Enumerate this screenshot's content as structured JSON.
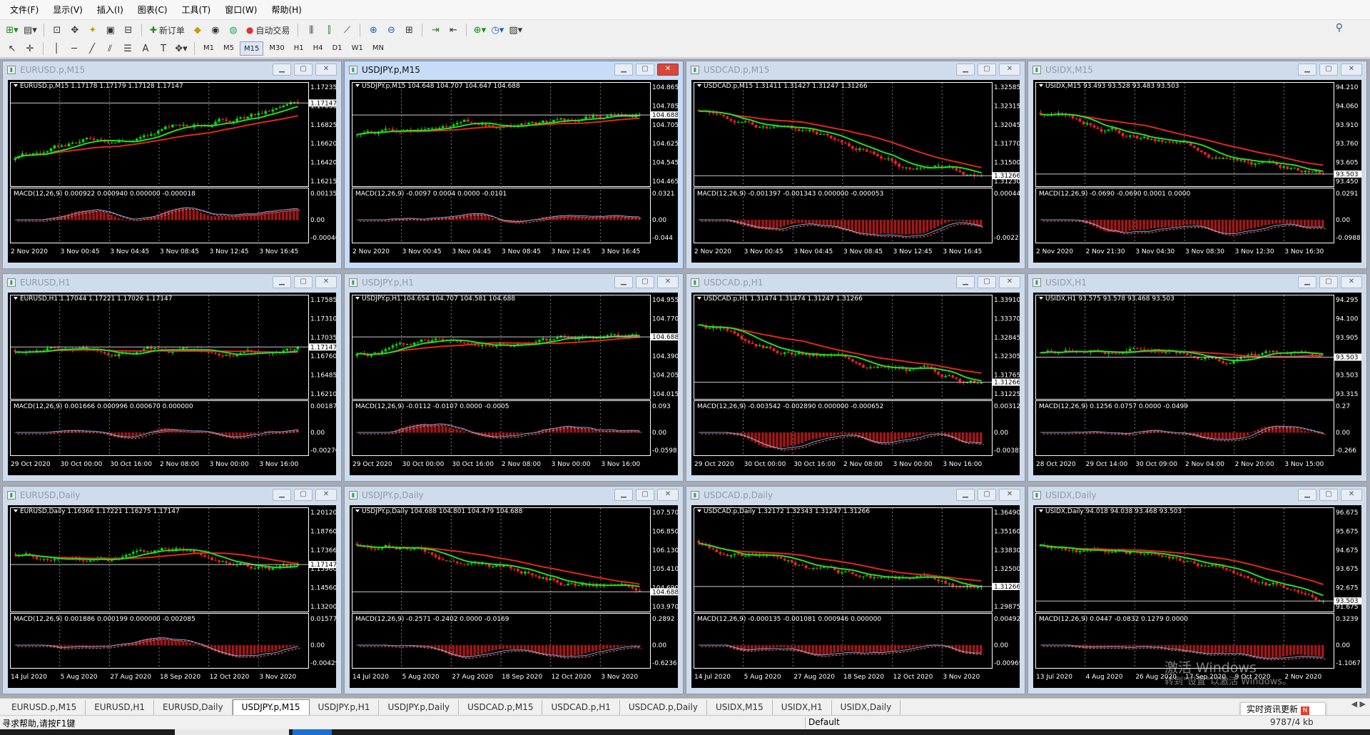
{
  "menu": [
    "文件(F)",
    "显示(V)",
    "插入(I)",
    "图表(C)",
    "工具(T)",
    "窗口(W)",
    "帮助(H)"
  ],
  "toolbar": {
    "new_order": "新订单",
    "auto_trading": "自动交易"
  },
  "timeframes": [
    "M1",
    "M5",
    "M15",
    "M30",
    "H1",
    "H4",
    "D1",
    "W1",
    "MN"
  ],
  "active_timeframe": "M15",
  "colors": {
    "bull": "#00e000",
    "bear": "#ff2020",
    "ma_fast": "#22dd22",
    "ma_slow": "#e02818",
    "macd_hist": "#a01818",
    "macd_signal": "#ff6a6a",
    "grid": "#7a7a7a",
    "axis": "#ffffff"
  },
  "charts": [
    {
      "title": "EURUSD.p,M15",
      "info": "EURUSD.p,M15  1.17178 1.17179 1.17128 1.17147",
      "prices": [
        "1.17235",
        "1.17030",
        "1.16825",
        "1.16620",
        "1.16420",
        "1.16215"
      ],
      "bid": "1.17147",
      "macd_info": "MACD(12,26,9) 0.000922 0.000940 0.000000 -0.000018",
      "macd_ticks": [
        "0.001352",
        "0.00",
        "-0.000465"
      ],
      "times": [
        "2 Nov 2020",
        "3 Nov 00:45",
        "3 Nov 04:45",
        "3 Nov 08:45",
        "3 Nov 12:45",
        "3 Nov 16:45"
      ],
      "active": false
    },
    {
      "title": "USDJPY.p,M15",
      "info": "USDJPY.p,M15  104.648 104.707 104.647 104.688",
      "prices": [
        "104.865",
        "104.785",
        "104.705",
        "104.625",
        "104.545",
        "104.465"
      ],
      "bid": "104.688",
      "macd_info": "MACD(12,26,9) -0.0097 0.0004 0.0000 -0.0101",
      "macd_ticks": [
        "0.0321",
        "0.00",
        "-0.044"
      ],
      "times": [
        "2 Nov 2020",
        "3 Nov 00:45",
        "3 Nov 04:45",
        "3 Nov 08:45",
        "3 Nov 12:45",
        "3 Nov 16:45"
      ],
      "active": true
    },
    {
      "title": "USDCAD.p,M15",
      "info": "USDCAD.p,M15  1.31411 1.31427 1.31247 1.31266",
      "prices": [
        "1.32585",
        "1.32315",
        "1.32045",
        "1.31770",
        "1.31500",
        "1.31230"
      ],
      "bid": "1.31266",
      "macd_info": "MACD(12,26,9) -0.001397 -0.001343 0.000000 -0.000053",
      "macd_ticks": [
        "0.000445",
        "-0.002219"
      ],
      "times": [
        "2 Nov 2020",
        "3 Nov 00:45",
        "3 Nov 04:45",
        "3 Nov 08:45",
        "3 Nov 12:45",
        "3 Nov 16:45"
      ],
      "active": false
    },
    {
      "title": "USIDX,M15",
      "info": "USIDX,M15  93.493 93.528 93.483 93.503",
      "prices": [
        "94.210",
        "94.060",
        "93.910",
        "93.760",
        "93.605",
        "93.450"
      ],
      "bid": "93.503",
      "macd_info": "MACD(12,26,9) -0.0690 -0.0690 0.0001 0.0000",
      "macd_ticks": [
        "0.0291",
        "0.00",
        "-0.0988"
      ],
      "times": [
        "2 Nov 2020",
        "2 Nov 21:30",
        "3 Nov 04:30",
        "3 Nov 08:30",
        "3 Nov 12:30",
        "3 Nov 16:30"
      ],
      "active": false
    },
    {
      "title": "EURUSD,H1",
      "info": "EURUSD,H1  1.17044 1.17221 1.17026 1.17147",
      "prices": [
        "1.17585",
        "1.17310",
        "1.17035",
        "1.16760",
        "1.16485",
        "1.16210"
      ],
      "bid": "1.17147",
      "macd_info": "MACD(12,26,9) 0.001666 0.000996 0.000670 0.000000",
      "macd_ticks": [
        "0.001875",
        "0.00",
        "-0.002704"
      ],
      "times": [
        "29 Oct 2020",
        "30 Oct 00:00",
        "30 Oct 16:00",
        "2 Nov 08:00",
        "3 Nov 00:00",
        "3 Nov 16:00"
      ],
      "active": false
    },
    {
      "title": "USDJPY.p,H1",
      "info": "USDJPY.p,H1  104.654 104.707 104.581 104.688",
      "prices": [
        "104.955",
        "104.770",
        "104.580",
        "104.390",
        "104.205",
        "104.015"
      ],
      "bid": "104.688",
      "macd_info": "MACD(12,26,9) -0.0112 -0.0107 0.0000 -0.0005",
      "macd_ticks": [
        "0.093",
        "0.00",
        "-0.0598"
      ],
      "times": [
        "29 Oct 2020",
        "30 Oct 00:00",
        "30 Oct 16:00",
        "2 Nov 08:00",
        "3 Nov 00:00",
        "3 Nov 16:00"
      ],
      "active": false
    },
    {
      "title": "USDCAD.p,H1",
      "info": "USDCAD.p,H1  1.31474 1.31474 1.31247 1.31266",
      "prices": [
        "1.33910",
        "1.33370",
        "1.32845",
        "1.32305",
        "1.31765",
        "1.31225"
      ],
      "bid": "1.31266",
      "macd_info": "MACD(12,26,9) -0.003542 -0.002890 0.000000 -0.000652",
      "macd_ticks": [
        "0.00312",
        "0.00",
        "-0.003859"
      ],
      "times": [
        "29 Oct 2020",
        "30 Oct 00:00",
        "30 Oct 16:00",
        "2 Nov 08:00",
        "3 Nov 00:00",
        "3 Nov 16:00"
      ],
      "active": false
    },
    {
      "title": "USIDX,H1",
      "info": "USIDX,H1  93.575 93.578 93.468 93.503",
      "prices": [
        "94.295",
        "94.100",
        "93.905",
        "93.700",
        "93.503",
        "93.315"
      ],
      "bid": "93.503",
      "macd_info": "MACD(12,26,9) 0.1256 0.0757 0.0000 -0.0499",
      "macd_ticks": [
        "0.27",
        "0.00",
        "-0.266"
      ],
      "times": [
        "28 Oct 2020",
        "29 Oct 14:00",
        "30 Oct 09:00",
        "2 Nov 04:00",
        "2 Nov 20:00",
        "3 Nov 15:00"
      ],
      "active": false
    },
    {
      "title": "EURUSD,Daily",
      "info": "EURUSD,Daily  1.16366 1.17221 1.16275 1.17147",
      "prices": [
        "1.20120",
        "1.18760",
        "1.17366",
        "1.15960",
        "1.14560",
        "1.13200"
      ],
      "bid": "1.17147",
      "macd_info": "MACD(12,26,9) 0.001886 0.000199 0.000000 -0.002085",
      "macd_ticks": [
        "0.015777",
        "0.00",
        "-0.004296"
      ],
      "times": [
        "14 Jul 2020",
        "5 Aug 2020",
        "27 Aug 2020",
        "18 Sep 2020",
        "12 Oct 2020",
        "3 Nov 2020"
      ],
      "active": false
    },
    {
      "title": "USDJPY.p,Daily",
      "info": "USDJPY.p,Daily  104.688 104.801 104.479 104.688",
      "prices": [
        "107.570",
        "106.850",
        "106.130",
        "105.410",
        "104.690",
        "103.970"
      ],
      "bid": "104.688",
      "macd_info": "MACD(12,26,9) -0.2571 -0.2402 0.0000 -0.0169",
      "macd_ticks": [
        "0.2892",
        "0.00",
        "-0.6236"
      ],
      "times": [
        "14 Jul 2020",
        "5 Aug 2020",
        "27 Aug 2020",
        "18 Sep 2020",
        "12 Oct 2020",
        "3 Nov 2020"
      ],
      "active": false
    },
    {
      "title": "USDCAD.p,Daily",
      "info": "USDCAD.p,Daily  1.32172 1.32343 1.31247 1.31266",
      "prices": [
        "1.36490",
        "1.35160",
        "1.33830",
        "1.32500",
        "1.31170",
        "1.29875"
      ],
      "bid": "1.31266",
      "macd_info": "MACD(12,26,9) -0.000135 -0.001081 0.000946 0.000000",
      "macd_ticks": [
        "0.004924",
        "0.00",
        "-0.009695"
      ],
      "times": [
        "14 Jul 2020",
        "5 Aug 2020",
        "27 Aug 2020",
        "18 Sep 2020",
        "12 Oct 2020",
        "3 Nov 2020"
      ],
      "active": false
    },
    {
      "title": "USIDX,Daily",
      "info": "USIDX,Daily  94.018 94.038 93.468 93.503",
      "prices": [
        "96.675",
        "95.675",
        "94.675",
        "93.675",
        "92.675",
        "91.675"
      ],
      "bid": "93.503",
      "macd_info": "MACD(12,26,9) 0.0447 -0.0832 0.1279 0.0000",
      "macd_ticks": [
        "0.3239",
        "0.00",
        "-1.1067"
      ],
      "times": [
        "13 Jul 2020",
        "4 Aug 2020",
        "26 Aug 2020",
        "17 Sep 2020",
        "9 Oct 2020",
        "2 Nov 2020"
      ],
      "active": false
    }
  ],
  "tabs": [
    "EURUSD.p,M15",
    "EURUSD,H1",
    "EURUSD,Daily",
    "USDJPY.p,M15",
    "USDJPY.p,H1",
    "USDJPY.p,Daily",
    "USDCAD.p,M15",
    "USDCAD.p,H1",
    "USDCAD.p,Daily",
    "USIDX,M15",
    "USIDX,H1",
    "USIDX,Daily"
  ],
  "active_tab": 3,
  "status": {
    "help": "寻求帮助,请按F1键",
    "profile": "Default",
    "traffic": "9787/4 kb"
  },
  "news_button": "实时资讯更新",
  "watermark": {
    "line1": "激活 Windows",
    "line2": "转到\"设置\"以激活 Windows。"
  }
}
